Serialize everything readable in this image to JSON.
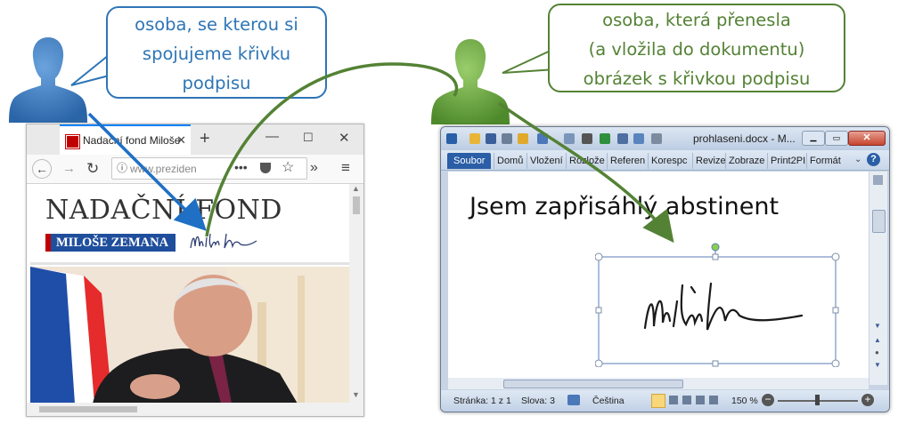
{
  "bubbles": {
    "left": [
      "osoba, se kterou si",
      "spojujeme křivku",
      "podpisu"
    ],
    "right": [
      "osoba, která přenesla",
      "(a vložila do dokumentu)",
      "obrázek s křivkou podpisu"
    ]
  },
  "colors": {
    "blue_person": "#2e75b6",
    "green_person": "#70ad47",
    "blue_arrow": "#1f6fc5",
    "green_arrow": "#548235"
  },
  "browser": {
    "tab_title": "Nadační fond Miloše",
    "new_tab": "+",
    "url": "www.preziden",
    "page_title_line1": "NADAČNÍ FOND",
    "page_title_line2": "MILOŠE ZEMANA",
    "icons": [
      "back-icon",
      "forward-icon",
      "reload-icon",
      "info-icon",
      "more-icon",
      "pocket-icon",
      "bookmark-star-icon",
      "overflow-icon",
      "menu-icon"
    ]
  },
  "word": {
    "window_title": "prohlaseni.docx - M...",
    "tabs": [
      "Soubor",
      "Domů",
      "Vložení",
      "Rozlože",
      "Referen",
      "Korespc",
      "Revize",
      "Zobraze",
      "Print2PI",
      "Formát"
    ],
    "document_text": "Jsem zapřisáhlý abstinent",
    "status": {
      "page": "Stránka: 1 z 1",
      "words": "Slova: 3",
      "language": "Čeština",
      "zoom": "150 %"
    }
  }
}
